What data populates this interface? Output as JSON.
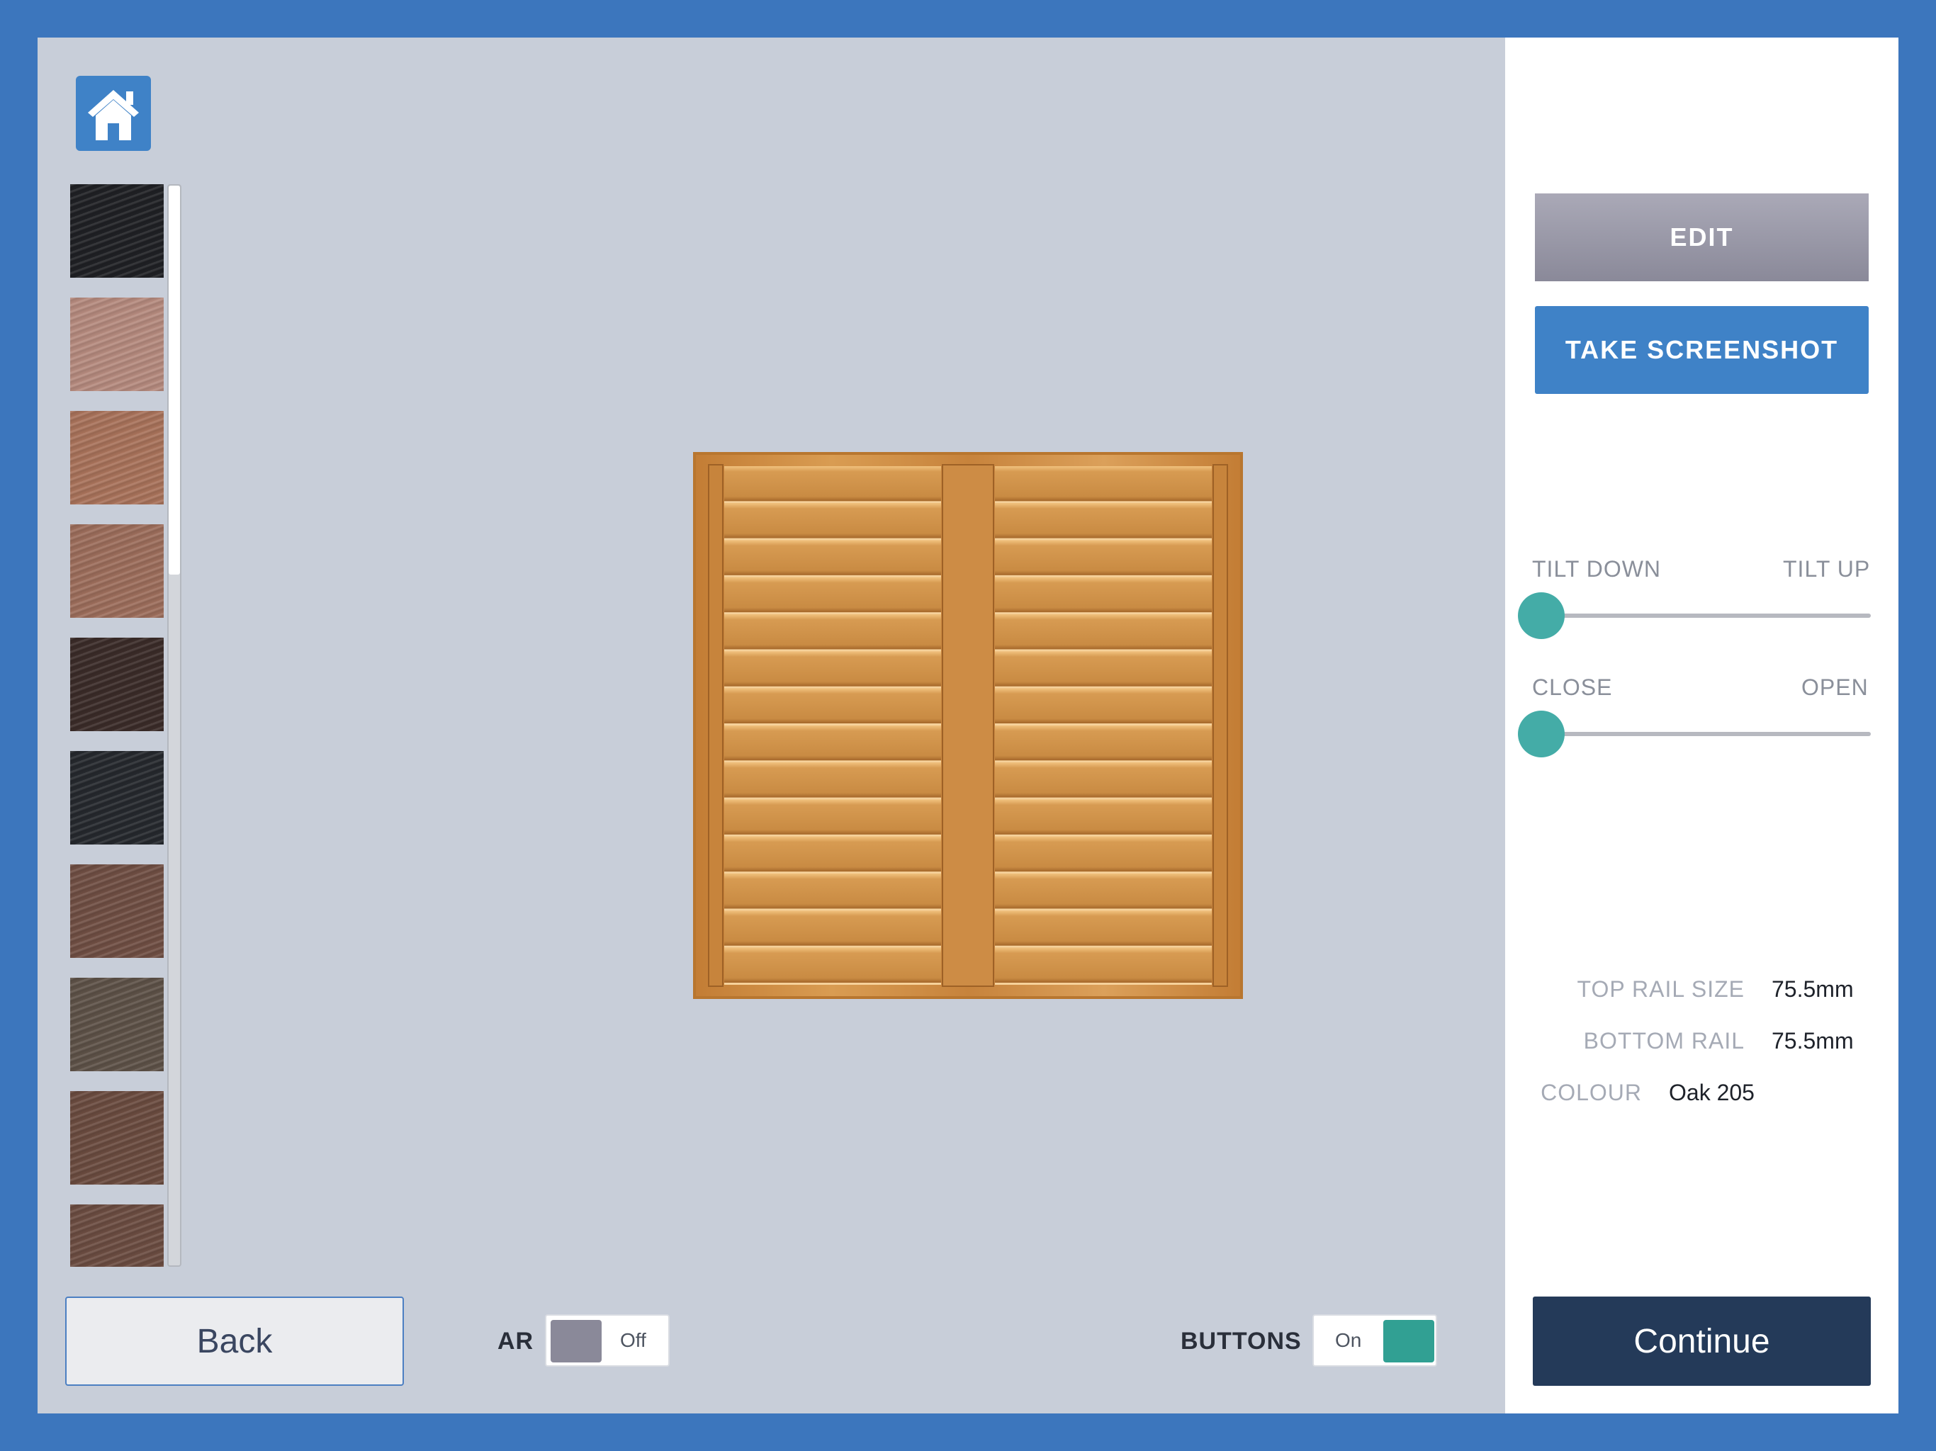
{
  "home": {
    "icon": "home-icon"
  },
  "swatches": {
    "items": [
      {
        "name": "black",
        "color": "#1f2024"
      },
      {
        "name": "pink-light",
        "color": "#b58a7e"
      },
      {
        "name": "terracotta",
        "color": "#a8725a"
      },
      {
        "name": "terracotta-2",
        "color": "#9c6d5b"
      },
      {
        "name": "dark-brown",
        "color": "#3a2b28"
      },
      {
        "name": "charcoal",
        "color": "#25282d"
      },
      {
        "name": "mahogany",
        "color": "#6f4e43"
      },
      {
        "name": "smoke-brown",
        "color": "#5d5147"
      },
      {
        "name": "walnut",
        "color": "#6a4b3f"
      },
      {
        "name": "cocoa",
        "color": "#6b4c41"
      }
    ],
    "scroll_fraction": 0.36
  },
  "buttons": {
    "back": "Back",
    "edit": "EDIT",
    "screenshot": "TAKE SCREENSHOT",
    "continue": "Continue"
  },
  "toggles": {
    "ar": {
      "label": "AR",
      "state": "Off"
    },
    "buttons": {
      "label": "BUTTONS",
      "state": "On"
    }
  },
  "sliders": {
    "tilt": {
      "left_label": "TILT DOWN",
      "right_label": "TILT UP",
      "value": 0
    },
    "open": {
      "left_label": "CLOSE",
      "right_label": "OPEN",
      "value": 0
    }
  },
  "specs": {
    "top_rail": {
      "label": "TOP RAIL SIZE",
      "value": "75.5mm"
    },
    "bottom_rail": {
      "label": "BOTTOM RAIL",
      "value": "75.5mm"
    },
    "colour": {
      "label": "COLOUR",
      "value": "Oak 205"
    }
  },
  "colors": {
    "frame_blue": "#3c76bd",
    "viewport_bg": "#c8ced9",
    "accent_teal": "#44aca7",
    "primary_blue": "#3f82c7",
    "navy": "#243a59",
    "toggle_off_gray": "#8a8999",
    "toggle_on_teal": "#31a093",
    "wood_light": "#d89a4f",
    "wood_dark": "#b8762f"
  },
  "shutter": {
    "product": "shutter",
    "panels": 2,
    "louvres_per_panel": 14
  }
}
